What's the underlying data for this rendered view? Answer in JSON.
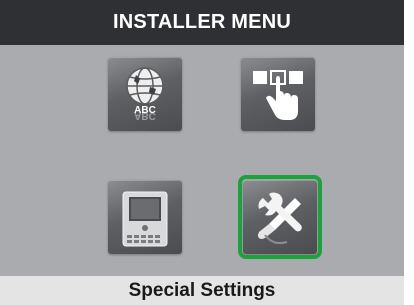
{
  "header": {
    "title": "INSTALLER MENU"
  },
  "icons": {
    "language": {
      "icon": "globe-abc-icon",
      "abc_text": "ABC",
      "abc_mirror": "ABC"
    },
    "configuration": {
      "icon": "hand-touch-icon"
    },
    "device": {
      "icon": "intercom-device-icon"
    },
    "special_settings": {
      "icon": "wrench-screwdriver-icon",
      "selected": true
    }
  },
  "footer": {
    "label": "Special Settings"
  },
  "colors": {
    "header_bg": "#2e3033",
    "screen_bg": "#a9abaf",
    "footer_bg": "#e4e4e4",
    "selection": "#19a33a"
  }
}
